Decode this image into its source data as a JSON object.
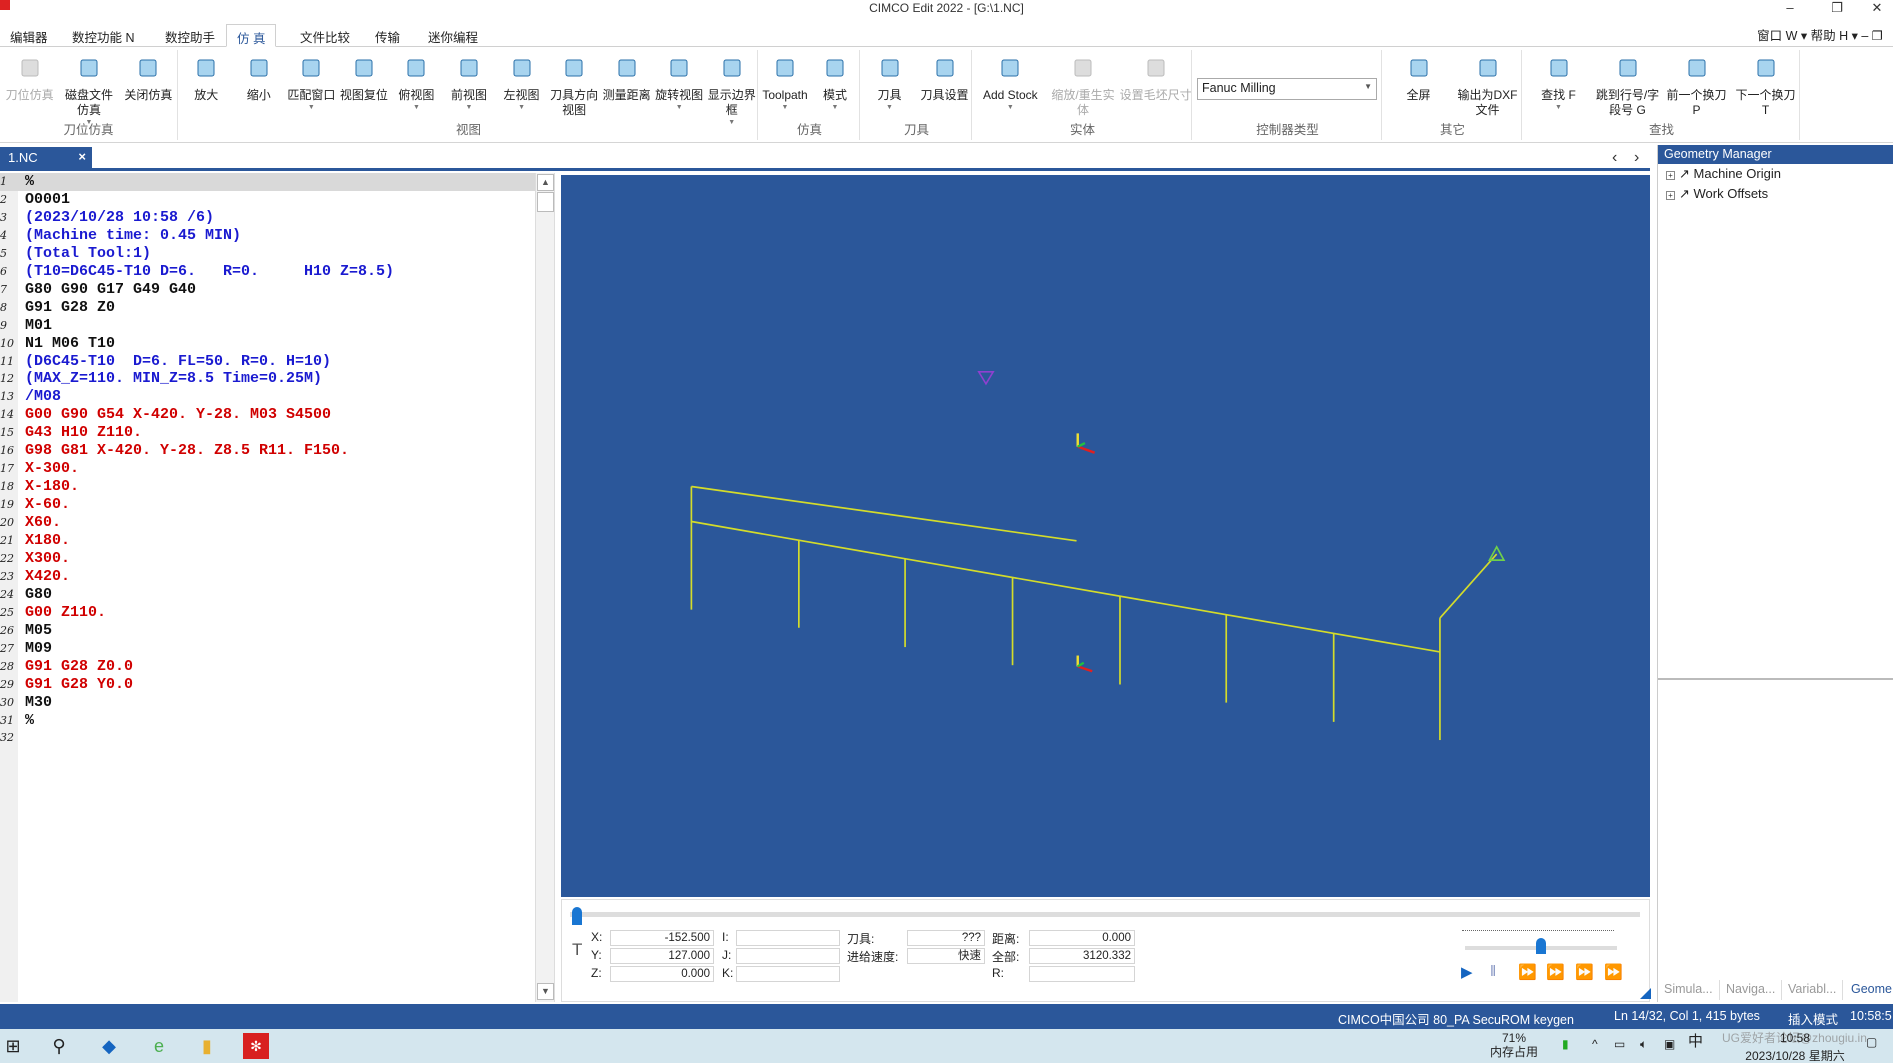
{
  "window": {
    "title": "CIMCO Edit 2022 - [G:\\1.NC]",
    "minimize": "–",
    "restore": "❐",
    "close": "✕"
  },
  "menu": {
    "tabs": [
      "编辑器",
      "数控功能 N",
      "数控助手",
      "仿 真",
      "文件比较",
      "传输",
      "迷你编程"
    ],
    "active": 3,
    "right": "窗口 W ▾  帮助 H ▾  ‒  ❐"
  },
  "ribbon": {
    "groups": [
      {
        "label": "刀位仿真",
        "buttons": [
          {
            "label": "刀位仿真",
            "icon": "toolpath-sim-icon",
            "disabled": true
          },
          {
            "label": "磁盘文件仿真",
            "icon": "disk-file-sim-icon",
            "caret": true
          },
          {
            "label": "关闭仿真",
            "icon": "close-sim-icon"
          }
        ]
      },
      {
        "label": "视图",
        "buttons": [
          {
            "label": "放大",
            "icon": "zoom-in-icon"
          },
          {
            "label": "缩小",
            "icon": "zoom-out-icon"
          },
          {
            "label": "匹配窗口",
            "icon": "fit-window-icon",
            "caret": true
          },
          {
            "label": "视图复位",
            "icon": "view-reset-icon"
          },
          {
            "label": "俯视图",
            "icon": "top-view-icon",
            "caret": true
          },
          {
            "label": "前视图",
            "icon": "front-view-icon",
            "caret": true
          },
          {
            "label": "左视图",
            "icon": "left-view-icon",
            "caret": true
          },
          {
            "label": "刀具方向视图",
            "icon": "tool-direction-view-icon"
          },
          {
            "label": "测量距离",
            "icon": "ruler-icon"
          },
          {
            "label": "旋转视图",
            "icon": "rotate-view-icon",
            "caret": true
          },
          {
            "label": "显示边界框",
            "icon": "bounding-box-icon",
            "caret": true
          }
        ]
      },
      {
        "label": "仿真",
        "buttons": [
          {
            "label": "Toolpath",
            "icon": "toolpath-icon",
            "caret": true
          },
          {
            "label": "模式",
            "icon": "mode-icon",
            "caret": true
          }
        ]
      },
      {
        "label": "刀具",
        "buttons": [
          {
            "label": "刀具",
            "icon": "tool-icon",
            "caret": true
          },
          {
            "label": "刀具设置",
            "icon": "tool-settings-icon"
          }
        ]
      },
      {
        "label": "实体",
        "buttons": [
          {
            "label": "Add Stock",
            "icon": "add-stock-icon",
            "caret": true
          },
          {
            "label": "缩放/重生实体",
            "icon": "regen-solid-icon",
            "disabled": true
          },
          {
            "label": "设置毛坯尺寸",
            "icon": "stock-size-icon",
            "disabled": true
          }
        ]
      },
      {
        "label": "控制器类型",
        "select": "Fanuc Milling"
      },
      {
        "label": "其它",
        "buttons": [
          {
            "label": "全屏",
            "icon": "fullscreen-icon"
          },
          {
            "label": "输出为DXF文件",
            "icon": "dxf-export-icon"
          }
        ]
      },
      {
        "label": "查找",
        "buttons": [
          {
            "label": "查找 F",
            "icon": "find-icon",
            "caret": true
          },
          {
            "label": "跳到行号/字段号 G",
            "icon": "goto-line-icon"
          },
          {
            "label": "前一个换刀 P",
            "icon": "prev-tool-change-icon"
          },
          {
            "label": "下一个换刀 T",
            "icon": "next-tool-change-icon"
          }
        ]
      }
    ]
  },
  "doc_tab": {
    "label": "1.NC",
    "close": "×",
    "prev": "‹",
    "next": "›"
  },
  "editor": {
    "current_line": 1,
    "lines": [
      {
        "text": "%",
        "color": "black"
      },
      {
        "text": "O0001",
        "color": "black"
      },
      {
        "text": "(2023/10/28 10:58 /6)",
        "color": "blue"
      },
      {
        "text": "(Machine time: 0.45 MIN)",
        "color": "blue"
      },
      {
        "text": "(Total Tool:1)",
        "color": "blue"
      },
      {
        "text": "(T10=D6C45-T10 D=6.   R=0.     H10 Z=8.5)",
        "color": "blue"
      },
      {
        "text": "G80 G90 G17 G49 G40",
        "color": "black"
      },
      {
        "text": "G91 G28 Z0",
        "color": "black"
      },
      {
        "text": "M01",
        "color": "black"
      },
      {
        "text": "N1 M06 T10",
        "color": "black"
      },
      {
        "text": "(D6C45-T10  D=6. FL=50. R=0. H=10)",
        "color": "blue"
      },
      {
        "text": "(MAX_Z=110. MIN_Z=8.5 Time=0.25M)",
        "color": "blue"
      },
      {
        "text": "/M08",
        "color": "blue"
      },
      {
        "text": "G00 G90 G54 X-420. Y-28. M03 S4500",
        "color": "red"
      },
      {
        "text": "G43 H10 Z110.",
        "color": "red"
      },
      {
        "text": "G98 G81 X-420. Y-28. Z8.5 R11. F150.",
        "color": "red"
      },
      {
        "text": "X-300.",
        "color": "red"
      },
      {
        "text": "X-180.",
        "color": "red"
      },
      {
        "text": "X-60.",
        "color": "red"
      },
      {
        "text": "X60.",
        "color": "red"
      },
      {
        "text": "X180.",
        "color": "red"
      },
      {
        "text": "X300.",
        "color": "red"
      },
      {
        "text": "X420.",
        "color": "red"
      },
      {
        "text": "G80",
        "color": "black"
      },
      {
        "text": "G00 Z110.",
        "color": "red"
      },
      {
        "text": "M05",
        "color": "black"
      },
      {
        "text": "M09",
        "color": "black"
      },
      {
        "text": "G91 G28 Z0.0",
        "color": "red"
      },
      {
        "text": "G91 G28 Y0.0",
        "color": "red"
      },
      {
        "text": "M30",
        "color": "black"
      },
      {
        "text": "%",
        "color": "black"
      },
      {
        "text": "",
        "color": "black"
      }
    ]
  },
  "viewport": {
    "background": "#2b579a",
    "toolpath_color": "#d4dc2a"
  },
  "readout": {
    "x_label": "X:",
    "x": "-152.500",
    "y_label": "Y:",
    "y": "127.000",
    "z_label": "Z:",
    "z": "0.000",
    "i_label": "I:",
    "i": "",
    "j_label": "J:",
    "j": "",
    "k_label": "K:",
    "k": "",
    "tool_label": "刀具:",
    "tool": "???",
    "feed_label": "进给速度:",
    "feed": "快速",
    "dist_label": "距离:",
    "dist": "0.000",
    "total_label": "全部:",
    "total": "3120.332",
    "r_label": "R:",
    "r": ""
  },
  "progress": {
    "position_fraction": 0.0,
    "speed_fraction": 0.5
  },
  "playback": [
    "play",
    "pause",
    "step",
    "step-to-point",
    "step-z",
    "step-tool"
  ],
  "geometry_manager": {
    "title": "Geometry Manager",
    "items": [
      "Machine Origin",
      "Work Offsets"
    ]
  },
  "right_tabs": [
    "Simula...",
    "Naviga...",
    "Variabl...",
    "Geome"
  ],
  "status": {
    "license": "CIMCO中国公司 80_PA SecuROM keygen",
    "position": "Ln 14/32, Col 1, 415 bytes",
    "mode": "插入模式",
    "time": "10:58:5"
  },
  "taskbar": {
    "memory_percent": "71%",
    "memory_label": "内存占用",
    "clock": "10:58",
    "date": "2023/10/28 星期六",
    "ime": "中",
    "watermark": "UG爱好者论坛@zhougiu.in"
  }
}
